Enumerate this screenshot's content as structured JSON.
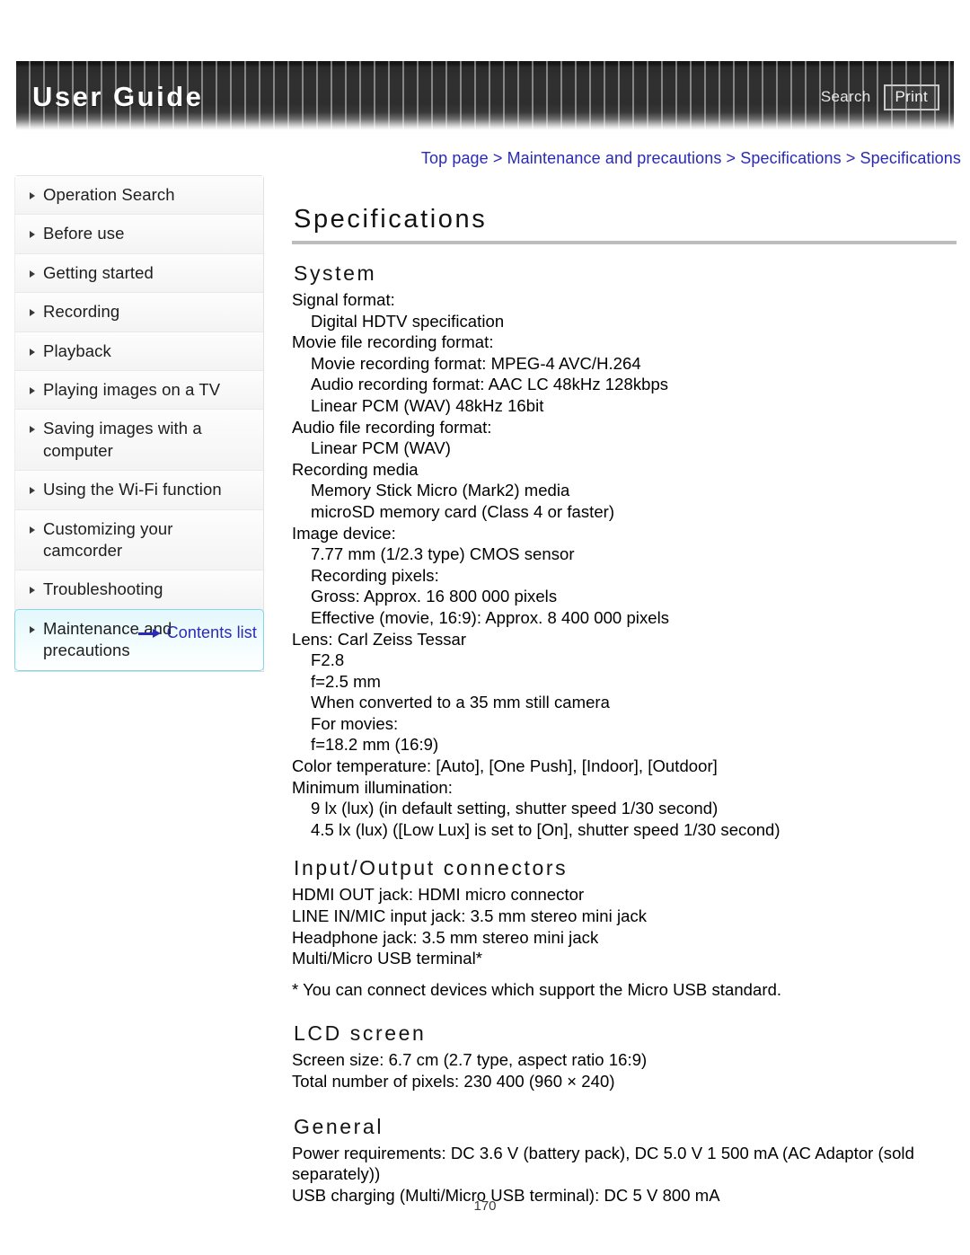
{
  "header": {
    "title": "User Guide",
    "search_label": "Search",
    "print_label": "Print"
  },
  "breadcrumb": {
    "text": "Top page > Maintenance and precautions > Specifications > Specifications"
  },
  "sidebar": {
    "items": [
      {
        "label": "Operation Search",
        "active": false
      },
      {
        "label": "Before use",
        "active": false
      },
      {
        "label": "Getting started",
        "active": false
      },
      {
        "label": "Recording",
        "active": false
      },
      {
        "label": "Playback",
        "active": false
      },
      {
        "label": "Playing images on a TV",
        "active": false
      },
      {
        "label": "Saving images with a computer",
        "active": false
      },
      {
        "label": "Using the Wi-Fi function",
        "active": false
      },
      {
        "label": "Customizing your camcorder",
        "active": false
      },
      {
        "label": "Troubleshooting",
        "active": false
      },
      {
        "label": "Maintenance and precautions",
        "active": true
      }
    ],
    "contents_list_label": "Contents list"
  },
  "main": {
    "page_title": "Specifications",
    "sections": [
      {
        "heading": "System",
        "lines": [
          {
            "text": "Signal format:",
            "indent": 0
          },
          {
            "text": "Digital HDTV specification",
            "indent": 1
          },
          {
            "text": "Movie file recording format:",
            "indent": 0
          },
          {
            "text": "Movie recording format: MPEG-4 AVC/H.264",
            "indent": 1
          },
          {
            "text": "Audio recording format: AAC LC 48kHz 128kbps",
            "indent": 1
          },
          {
            "text": "Linear PCM (WAV) 48kHz 16bit",
            "indent": 1
          },
          {
            "text": "Audio file recording format:",
            "indent": 0
          },
          {
            "text": "Linear PCM (WAV)",
            "indent": 1
          },
          {
            "text": "Recording media",
            "indent": 0
          },
          {
            "text": "Memory Stick Micro (Mark2) media",
            "indent": 1
          },
          {
            "text": "microSD memory card (Class 4 or faster)",
            "indent": 1
          },
          {
            "text": "Image device:",
            "indent": 0
          },
          {
            "text": "7.77 mm (1/2.3 type) CMOS sensor",
            "indent": 1
          },
          {
            "text": "Recording pixels:",
            "indent": 1
          },
          {
            "text": "Gross: Approx. 16 800 000 pixels",
            "indent": 1
          },
          {
            "text": "Effective (movie, 16:9): Approx. 8 400 000 pixels",
            "indent": 1
          },
          {
            "text": "Lens: Carl Zeiss Tessar",
            "indent": 0
          },
          {
            "text": "F2.8",
            "indent": 1
          },
          {
            "text": "f=2.5 mm",
            "indent": 1
          },
          {
            "text": "When converted to a 35 mm still camera",
            "indent": 1
          },
          {
            "text": "For movies:",
            "indent": 1
          },
          {
            "text": "f=18.2 mm (16:9)",
            "indent": 1
          },
          {
            "text": "Color temperature: [Auto], [One Push], [Indoor], [Outdoor]",
            "indent": 0
          },
          {
            "text": "Minimum illumination:",
            "indent": 0
          },
          {
            "text": "9 lx (lux) (in default setting, shutter speed 1/30 second)",
            "indent": 1
          },
          {
            "text": "4.5 lx (lux) ([Low Lux] is set to [On], shutter speed 1/30 second)",
            "indent": 1
          }
        ]
      },
      {
        "heading": "Input/Output connectors",
        "lines": [
          {
            "text": "HDMI OUT jack: HDMI micro connector",
            "indent": 0
          },
          {
            "text": "LINE IN/MIC input jack: 3.5 mm stereo mini jack",
            "indent": 0
          },
          {
            "text": "Headphone jack: 3.5 mm stereo mini jack",
            "indent": 0
          },
          {
            "text": "Multi/Micro USB terminal*",
            "indent": 0
          },
          {
            "text": "* You can connect devices which support the Micro USB standard.",
            "indent": 0,
            "footnote": true
          }
        ]
      },
      {
        "heading": "LCD screen",
        "lines": [
          {
            "text": "Screen size: 6.7 cm (2.7 type, aspect ratio 16:9)",
            "indent": 0
          },
          {
            "text": "Total number of pixels: 230 400 (960 × 240)",
            "indent": 0
          }
        ]
      },
      {
        "heading": "General",
        "lines": [
          {
            "text": "Power requirements: DC 3.6 V (battery pack), DC 5.0 V 1 500 mA (AC Adaptor (sold separately))",
            "indent": 0,
            "wrap": true
          },
          {
            "text": "USB charging (Multi/Micro USB terminal): DC 5 V 800 mA",
            "indent": 0
          }
        ]
      }
    ]
  },
  "footer": {
    "page_number": "170"
  },
  "colors": {
    "link": "#2a2ab4",
    "header_bg": "#2e2e2e",
    "active_border": "#7fd8e8",
    "rule": "#bdbdbd"
  }
}
